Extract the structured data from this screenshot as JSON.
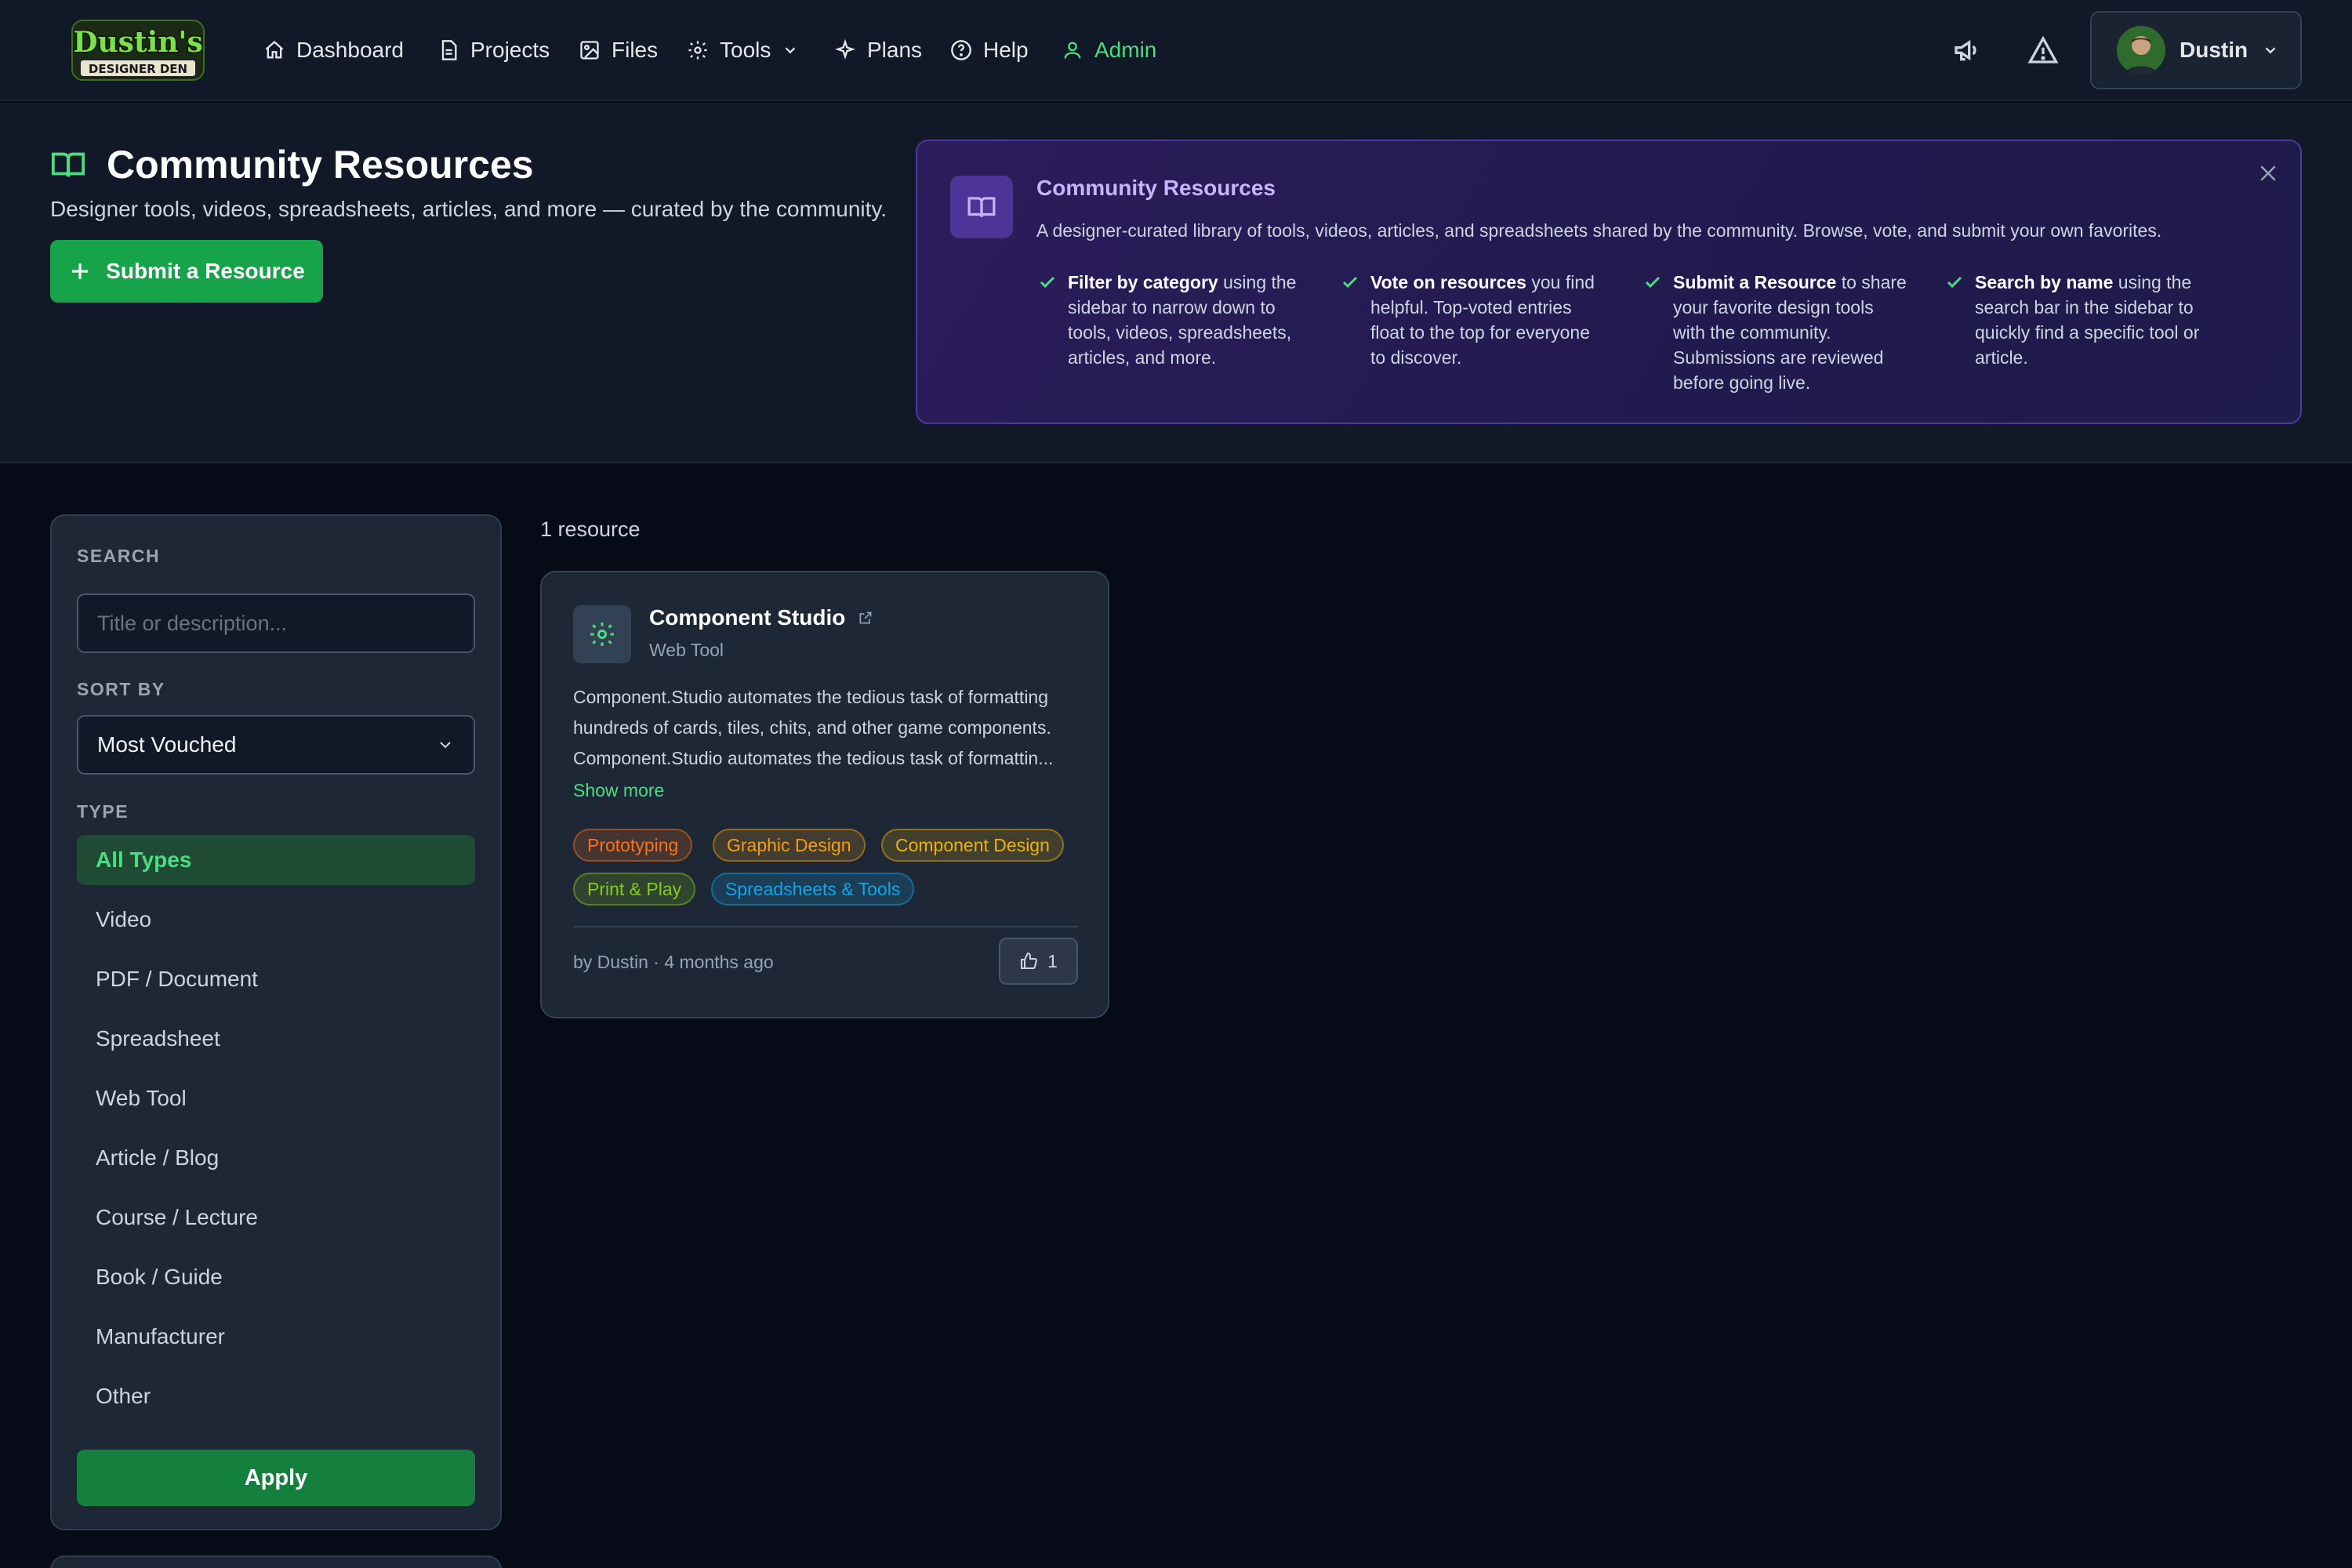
{
  "nav": {
    "logo_line1": "Dustin's",
    "logo_line2": "DESIGNER DEN",
    "items": [
      {
        "label": "Dashboard",
        "icon": "home-icon"
      },
      {
        "label": "Projects",
        "icon": "document-icon"
      },
      {
        "label": "Files",
        "icon": "image-icon"
      },
      {
        "label": "Tools",
        "icon": "gear-icon"
      },
      {
        "label": "Plans",
        "icon": "sparkle-icon"
      },
      {
        "label": "Help",
        "icon": "help-circle-icon"
      },
      {
        "label": "Admin",
        "icon": "user-icon"
      }
    ],
    "user_name": "Dustin"
  },
  "hero": {
    "title": "Community Resources",
    "subtitle": "Designer tools, videos, spreadsheets, articles, and more — curated by the community.",
    "submit_label": "Submit a Resource"
  },
  "info": {
    "title": "Community Resources",
    "description": "A designer-curated library of tools, videos, articles, and spreadsheets shared by the community. Browse, vote, and submit your own favorites.",
    "tips": [
      {
        "bold": "Filter by category",
        "text": " using the sidebar to narrow down to tools, videos, spreadsheets, articles, and more."
      },
      {
        "bold": "Vote on resources",
        "text": " you find helpful. Top-voted entries float to the top for everyone to discover."
      },
      {
        "bold": "Submit a Resource",
        "text": " to share your favorite design tools with the community. Submissions are reviewed before going live."
      },
      {
        "bold": "Search by name",
        "text": " using the search bar in the sidebar to quickly find a specific tool or article."
      }
    ]
  },
  "sidebar": {
    "search_label": "SEARCH",
    "search_placeholder": "Title or description...",
    "search_value": "",
    "sort_label": "SORT BY",
    "sort_value": "Most Vouched",
    "type_label": "TYPE",
    "types": [
      "All Types",
      "Video",
      "PDF / Document",
      "Spreadsheet",
      "Web Tool",
      "Article / Blog",
      "Course / Lecture",
      "Book / Guide",
      "Manufacturer",
      "Other"
    ],
    "active_type": "All Types",
    "apply_label": "Apply"
  },
  "results": {
    "count_text": "1 resource",
    "cards": [
      {
        "title": "Component Studio",
        "type": "Web Tool",
        "description_lines": [
          "Component.Studio automates the tedious task of formatting",
          "hundreds of cards, tiles, chits, and other game components.",
          "Component.Studio automates the tedious task of formattin..."
        ],
        "show_more": "Show more",
        "tags": [
          {
            "label": "Prototyping",
            "color": "#f97316"
          },
          {
            "label": "Graphic Design",
            "color": "#f59e0b"
          },
          {
            "label": "Component Design",
            "color": "#eab308"
          },
          {
            "label": "Print & Play",
            "color": "#84cc16"
          },
          {
            "label": "Spreadsheets & Tools",
            "color": "#0ea5e9"
          }
        ],
        "by_line": "by Dustin · 4 months ago",
        "votes": "1"
      }
    ]
  },
  "colors": {
    "accent_green": "#16a34a",
    "admin_green": "#4ade80",
    "info_purple": "#c4b5fd",
    "background": "#070b17"
  }
}
